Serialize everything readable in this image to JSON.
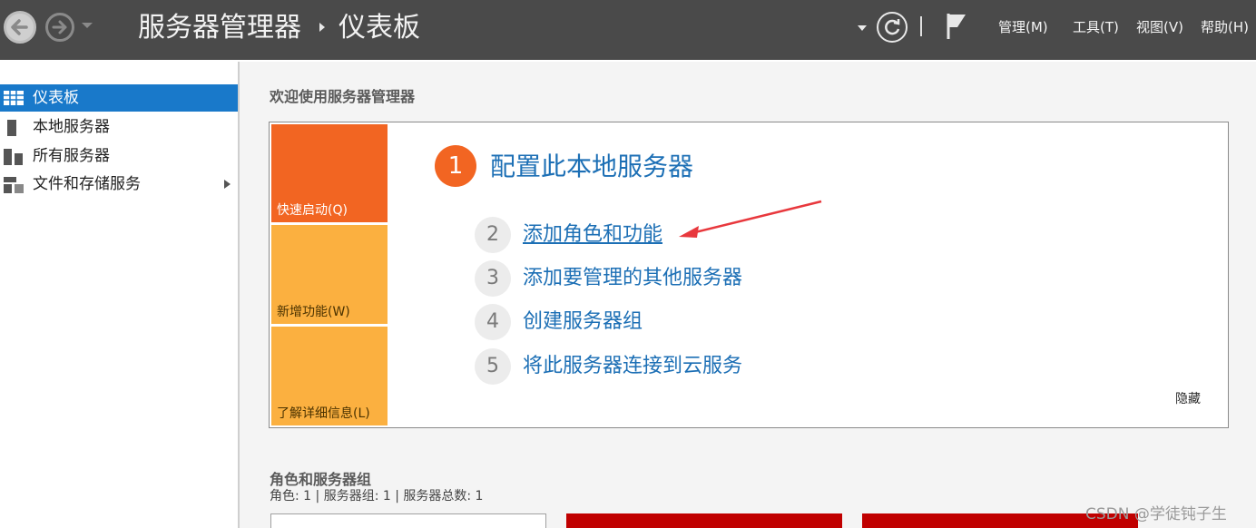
{
  "titlebar": {
    "breadcrumb_app": "服务器管理器",
    "breadcrumb_page": "仪表板",
    "menus": [
      "管理(M)",
      "工具(T)",
      "视图(V)",
      "帮助(H)"
    ]
  },
  "sidebar": {
    "items": [
      {
        "label": "仪表板",
        "icon": "dashboard-grid-icon",
        "active": true
      },
      {
        "label": "本地服务器",
        "icon": "server-icon"
      },
      {
        "label": "所有服务器",
        "icon": "servers-icon"
      },
      {
        "label": "文件和存储服务",
        "icon": "file-storage-icon",
        "has_arrow": true
      }
    ]
  },
  "main": {
    "welcome_title": "欢迎使用服务器管理器",
    "tiles": [
      "快速启动(Q)",
      "新增功能(W)",
      "了解详细信息(L)"
    ],
    "steps": [
      {
        "num": "1",
        "label": "配置此本地服务器"
      },
      {
        "num": "2",
        "label": "添加角色和功能"
      },
      {
        "num": "3",
        "label": "添加要管理的其他服务器"
      },
      {
        "num": "4",
        "label": "创建服务器组"
      },
      {
        "num": "5",
        "label": "将此服务器连接到云服务"
      }
    ],
    "hide_label": "隐藏",
    "roles_title": "角色和服务器组",
    "roles_summary": "角色: 1 | 服务器组: 1 | 服务器总数: 1"
  },
  "watermark": "CSDN @学徒钝子生",
  "colors": {
    "accent_orange": "#f26522",
    "tile_yellow": "#fbb040",
    "link_blue": "#1c6fb5",
    "active_blue": "#1979ca",
    "card_red": "#c00000"
  }
}
